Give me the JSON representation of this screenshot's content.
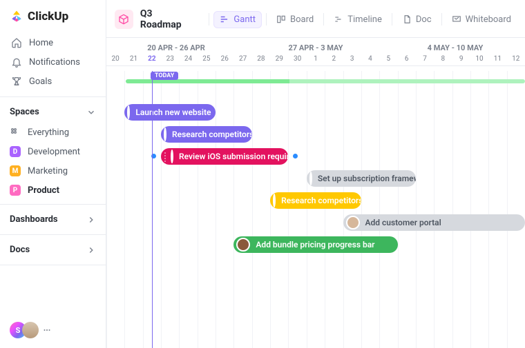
{
  "brand": "ClickUp",
  "sidebar": {
    "home": "Home",
    "notifications": "Notifications",
    "goals": "Goals",
    "spaces_header": "Spaces",
    "everything": "Everything",
    "dev": {
      "letter": "D",
      "label": "Development",
      "color": "#a963ff"
    },
    "mkt": {
      "letter": "M",
      "label": "Marketing",
      "color": "#ffb020"
    },
    "prd": {
      "letter": "P",
      "label": "Product",
      "color": "#ff6bc1"
    },
    "dashboards": "Dashboards",
    "docs": "Docs",
    "footer_initial": "S"
  },
  "header": {
    "title": "Q3 Roadmap",
    "tabs": {
      "gantt": "Gantt",
      "board": "Board",
      "timeline": "Timeline",
      "doc": "Doc",
      "whiteboard": "Whiteboard"
    }
  },
  "gantt": {
    "weeks": [
      "20 APR - 26 APR",
      "27 APR - 3 MAY",
      "4 MAY - 10 MAY"
    ],
    "days": [
      "20",
      "21",
      "22",
      "23",
      "24",
      "25",
      "26",
      "27",
      "28",
      "29",
      "30",
      "1",
      "2",
      "3",
      "4",
      "5",
      "6",
      "7",
      "8",
      "9",
      "10",
      "11",
      "12"
    ],
    "today_index": 2,
    "today_label": "TODAY",
    "tasks": [
      {
        "label": "Launch new website",
        "color": "#7b68ee",
        "start": 1,
        "span": 5,
        "avatar": "#f2c8a0"
      },
      {
        "label": "Research competitors",
        "color": "#7b68ee",
        "start": 3,
        "span": 5,
        "avatar": "#f7dcb3"
      },
      {
        "label": "Review iOS submission requirements",
        "color": "#e3125f",
        "start": 3,
        "span": 7,
        "avatar": "#f7e5c8",
        "dep_left": true,
        "dep_right": true,
        "draghandles": true
      },
      {
        "label": "Set up subscription framework",
        "color": "#d6d9de",
        "start": 11,
        "span": 6,
        "avatar": "#e8d1bb",
        "text": "dark"
      },
      {
        "label": "Research competitors",
        "color": "#ffc800",
        "start": 9,
        "span": 5,
        "avatar": "#b87d4d"
      },
      {
        "label": "Add customer portal",
        "color": "#d6d9de",
        "start": 13,
        "span": 10,
        "avatar": "#d6b79a",
        "text": "dark"
      },
      {
        "label": "Add bundle pricing progress bar",
        "color": "#3db65d",
        "start": 7,
        "span": 9,
        "avatar": "#8a5a3b"
      }
    ]
  }
}
